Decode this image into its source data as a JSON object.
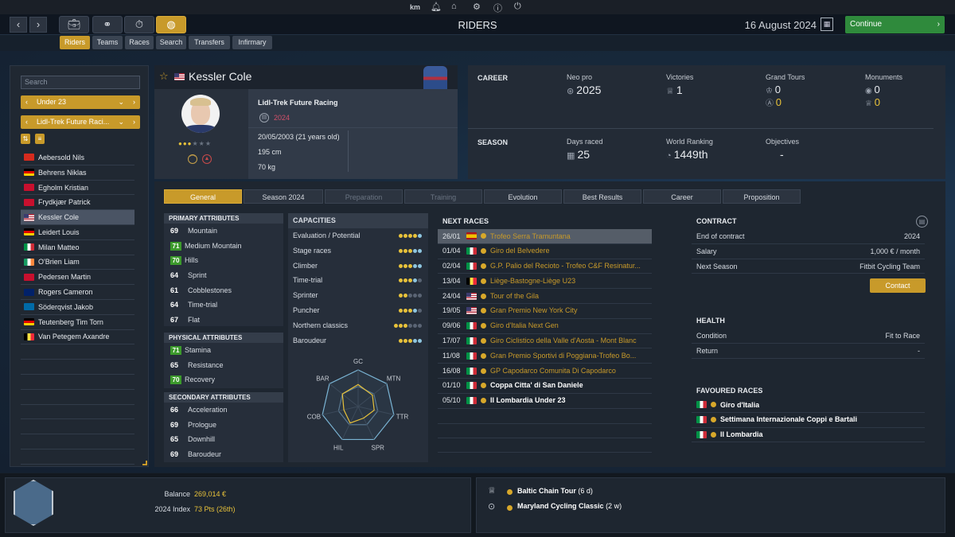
{
  "topbar": {
    "user": "km"
  },
  "nav": {
    "title": "RIDERS",
    "date": "16 August 2024",
    "continue_label": "Continue"
  },
  "subtabs": [
    "Riders",
    "Teams",
    "Races",
    "Search",
    "Transfers",
    "Infirmary"
  ],
  "left": {
    "search_placeholder": "Search",
    "age_filter": "Under 23",
    "team_filter": "Lidl-Trek Future Raci...",
    "riders": [
      {
        "name": "Aebersold Nils",
        "flag": "ch"
      },
      {
        "name": "Behrens Niklas",
        "flag": "de"
      },
      {
        "name": "Egholm Kristian",
        "flag": "dk"
      },
      {
        "name": "Frydkjær Patrick",
        "flag": "dk"
      },
      {
        "name": "Kessler Cole",
        "flag": "us",
        "selected": true
      },
      {
        "name": "Leidert Louis",
        "flag": "de"
      },
      {
        "name": "Milan Matteo",
        "flag": "it"
      },
      {
        "name": "O'Brien Liam",
        "flag": "ie"
      },
      {
        "name": "Pedersen Martin",
        "flag": "dk"
      },
      {
        "name": "Rogers Cameron",
        "flag": "au"
      },
      {
        "name": "Söderqvist Jakob",
        "flag": "se"
      },
      {
        "name": "Teutenberg Tim Torn",
        "flag": "de"
      },
      {
        "name": "Van Petegem Axandre",
        "flag": "be"
      }
    ]
  },
  "profile": {
    "name": "Kessler Cole",
    "team": "Lidl-Trek Future Racing",
    "contract_year": "2024",
    "dob": "20/05/2003 (21 years old)",
    "height": "195 cm",
    "weight": "70 kg",
    "stars": 3,
    "max_stars": 6
  },
  "career": {
    "label": "CAREER",
    "neo_pro_label": "Neo pro",
    "neo_pro": "2025",
    "victories_label": "Victories",
    "victories": "1",
    "grand_tours_label": "Grand Tours",
    "gt_a": "0",
    "gt_b": "0",
    "monuments_label": "Monuments",
    "mon_a": "0",
    "mon_b": "0"
  },
  "season": {
    "label": "SEASON",
    "days_raced_label": "Days raced",
    "days_raced": "25",
    "world_ranking_label": "World Ranking",
    "world_ranking": "1449th",
    "objectives_label": "Objectives",
    "objectives": "-"
  },
  "tabs": [
    {
      "label": "General",
      "state": "active"
    },
    {
      "label": "Season 2024",
      "state": "normal"
    },
    {
      "label": "Preparation",
      "state": "disabled"
    },
    {
      "label": "Training",
      "state": "disabled"
    },
    {
      "label": "Evolution",
      "state": "normal"
    },
    {
      "label": "Best Results",
      "state": "normal"
    },
    {
      "label": "Career",
      "state": "normal"
    },
    {
      "label": "Proposition",
      "state": "normal"
    }
  ],
  "primary": {
    "title": "PRIMARY ATTRIBUTES",
    "rows": [
      {
        "v": "69",
        "n": "Mountain"
      },
      {
        "v": "71",
        "n": "Medium Mountain",
        "g": true
      },
      {
        "v": "70",
        "n": "Hills",
        "g": true
      },
      {
        "v": "64",
        "n": "Sprint"
      },
      {
        "v": "61",
        "n": "Cobblestones"
      },
      {
        "v": "64",
        "n": "Time-trial"
      },
      {
        "v": "67",
        "n": "Flat"
      }
    ]
  },
  "physical": {
    "title": "PHYSICAL ATTRIBUTES",
    "rows": [
      {
        "v": "71",
        "n": "Stamina",
        "g": true
      },
      {
        "v": "65",
        "n": "Resistance"
      },
      {
        "v": "70",
        "n": "Recovery",
        "g": true
      }
    ]
  },
  "secondary": {
    "title": "SECONDARY ATTRIBUTES",
    "rows": [
      {
        "v": "66",
        "n": "Acceleration"
      },
      {
        "v": "69",
        "n": "Prologue"
      },
      {
        "v": "65",
        "n": "Downhill"
      },
      {
        "v": "69",
        "n": "Baroudeur"
      }
    ]
  },
  "capacities": {
    "title": "CAPACITIES",
    "rows": [
      {
        "n": "Evaluation / Potential",
        "d": "yyyyb"
      },
      {
        "n": "Stage races",
        "d": "yyybb"
      },
      {
        "n": "Climber",
        "d": "yyybb"
      },
      {
        "n": "Time-trial",
        "d": "yyybd"
      },
      {
        "n": "Sprinter",
        "d": "yyddd"
      },
      {
        "n": "Puncher",
        "d": "yyybd"
      },
      {
        "n": "Northern classics",
        "d": "yyyddd"
      },
      {
        "n": "Baroudeur",
        "d": "yyybb"
      }
    ]
  },
  "radar": {
    "labels": [
      "GC",
      "MTN",
      "TTR",
      "SPR",
      "HIL",
      "COB",
      "BAR"
    ],
    "values": [
      0.6,
      0.5,
      0.45,
      0.35,
      0.5,
      0.4,
      0.55
    ]
  },
  "next_races": {
    "title": "NEXT RACES",
    "rows": [
      {
        "date": "26/01",
        "flag": "es",
        "name": "Trofeo Serra Tramuntana",
        "hl": true
      },
      {
        "date": "01/04",
        "flag": "it",
        "name": "Giro del Belvedere"
      },
      {
        "date": "02/04",
        "flag": "it",
        "name": "G.P. Palio del Recioto - Trofeo C&F Resinatur..."
      },
      {
        "date": "13/04",
        "flag": "be",
        "name": "Liège-Bastogne-Liège U23"
      },
      {
        "date": "24/04",
        "flag": "us",
        "name": "Tour of the Gila"
      },
      {
        "date": "19/05",
        "flag": "us",
        "name": "Gran Premio New York City"
      },
      {
        "date": "09/06",
        "flag": "it",
        "name": "Giro d'Italia Next Gen"
      },
      {
        "date": "17/07",
        "flag": "it",
        "name": "Giro Ciclistico della Valle d'Aosta - Mont Blanc"
      },
      {
        "date": "11/08",
        "flag": "it",
        "name": "Gran Premio Sportivi di Poggiana-Trofeo Bo..."
      },
      {
        "date": "16/08",
        "flag": "it",
        "name": "GP Capodarco Comunita Di Capodarco"
      },
      {
        "date": "01/10",
        "flag": "it",
        "name": "Coppa Citta' di San Daniele",
        "w": true
      },
      {
        "date": "05/10",
        "flag": "it",
        "name": "Il Lombardia Under 23",
        "w": true
      }
    ]
  },
  "contract": {
    "title": "CONTRACT",
    "rows": [
      {
        "k": "End of contract",
        "v": "2024"
      },
      {
        "k": "Salary",
        "v": "1,000 € / month"
      },
      {
        "k": "Next Season",
        "v": "Fitbit Cycling Team"
      }
    ],
    "contact_label": "Contact"
  },
  "health": {
    "title": "HEALTH",
    "rows": [
      {
        "k": "Condition",
        "v": "Fit to Race"
      },
      {
        "k": "Return",
        "v": "-"
      }
    ]
  },
  "favoured": {
    "title": "FAVOURED RACES",
    "rows": [
      {
        "flag": "it",
        "name": "Giro d'Italia"
      },
      {
        "flag": "it",
        "name": "Settimana Internazionale Coppi e Bartali"
      },
      {
        "flag": "it",
        "name": "Il Lombardia"
      }
    ]
  },
  "footer": {
    "balance_label": "Balance",
    "balance": "269,014 €",
    "index_label": "2024 Index",
    "index": "73 Pts (26th)",
    "race1": "Baltic Chain Tour",
    "race1_d": "(6 d)",
    "race2": "Maryland Cycling Classic",
    "race2_d": "(2 w)"
  }
}
